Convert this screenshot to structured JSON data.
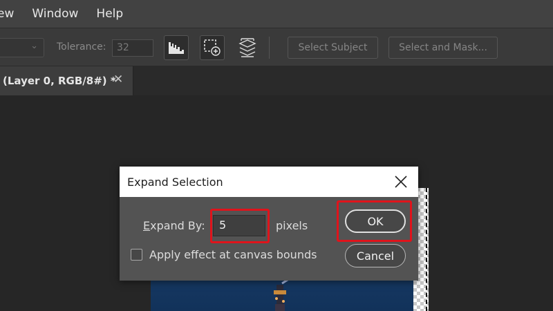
{
  "menubar": {
    "items": [
      "ew",
      "Window",
      "Help"
    ]
  },
  "options": {
    "tolerance_label": "Tolerance:",
    "tolerance_value": "32",
    "select_subject": "Select Subject",
    "select_and_mask": "Select and Mask..."
  },
  "document_tab": {
    "title": "(Layer 0, RGB/8#) *",
    "close": "✕"
  },
  "dialog": {
    "title": "Expand Selection",
    "expand_label_underlined": "E",
    "expand_label_rest": "xpand By:",
    "expand_value": "5",
    "unit": "pixels",
    "checkbox_label": "Apply effect at canvas bounds",
    "ok": "OK",
    "cancel": "Cancel"
  },
  "colors": {
    "highlight": "#e0131b",
    "menubar": "#424242",
    "canvas": "#262626"
  },
  "icons": [
    "chevron-down-icon",
    "sample-all-layers-icon",
    "add-to-selection-icon",
    "refine-edge-icon",
    "close-icon"
  ]
}
